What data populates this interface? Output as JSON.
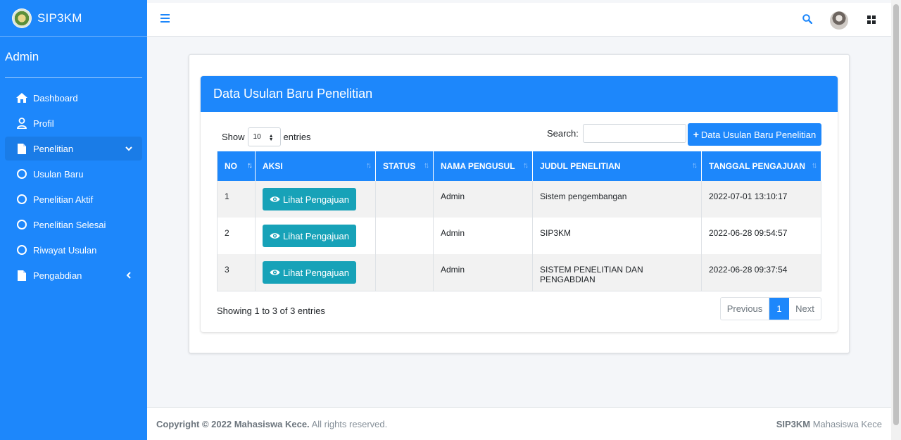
{
  "brand": {
    "name": "SIP3KM"
  },
  "user": {
    "name": "Admin"
  },
  "sidebar": {
    "items": [
      {
        "label": "Dashboard",
        "icon": "home-icon"
      },
      {
        "label": "Profil",
        "icon": "user-icon"
      },
      {
        "label": "Penelitian",
        "icon": "file-icon",
        "expanded": true
      },
      {
        "label": "Usulan Baru",
        "icon": "circle-icon"
      },
      {
        "label": "Penelitian Aktif",
        "icon": "circle-icon"
      },
      {
        "label": "Penelitian Selesai",
        "icon": "circle-icon"
      },
      {
        "label": "Riwayat Usulan",
        "icon": "circle-icon"
      },
      {
        "label": "Pengabdian",
        "icon": "file-icon",
        "expanded": false
      }
    ]
  },
  "main": {
    "card_title": "Data Usulan Baru Penelitian",
    "show_label": "Show",
    "entries_value": "10",
    "entries_label": "entries",
    "search_label": "Search:",
    "search_value": "",
    "add_button": "Data Usulan Baru Penelitian",
    "table": {
      "columns": [
        "NO",
        "AKSI",
        "STATUS",
        "NAMA PENGUSUL",
        "JUDUL PENELITIAN",
        "TANGGAL PENGAJUAN"
      ],
      "rows": [
        {
          "no": "1",
          "action": "Lihat Pengajuan",
          "status": "",
          "pengusul": "Admin",
          "judul": "Sistem pengembangan",
          "tanggal": "2022-07-01 13:10:17"
        },
        {
          "no": "2",
          "action": "Lihat Pengajuan",
          "status": "",
          "pengusul": "Admin",
          "judul": "SIP3KM",
          "tanggal": "2022-06-28 09:54:57"
        },
        {
          "no": "3",
          "action": "Lihat Pengajuan",
          "status": "",
          "pengusul": "Admin",
          "judul": "SISTEM PENELITIAN DAN PENGABDIAN",
          "tanggal": "2022-06-28 09:37:54"
        }
      ]
    },
    "info": "Showing 1 to 3 of 3 entries",
    "pagination": {
      "previous": "Previous",
      "current": "1",
      "next": "Next"
    }
  },
  "footer": {
    "copyright_bold": "Copyright © 2022 Mahasiswa Kece.",
    "copyright_rest": " All rights reserved.",
    "right_bold": "SIP3KM",
    "right_rest": " Mahasiswa Kece"
  },
  "colors": {
    "primary": "#1d87fb",
    "info": "#17a2b8",
    "background": "#f4f6f9"
  }
}
